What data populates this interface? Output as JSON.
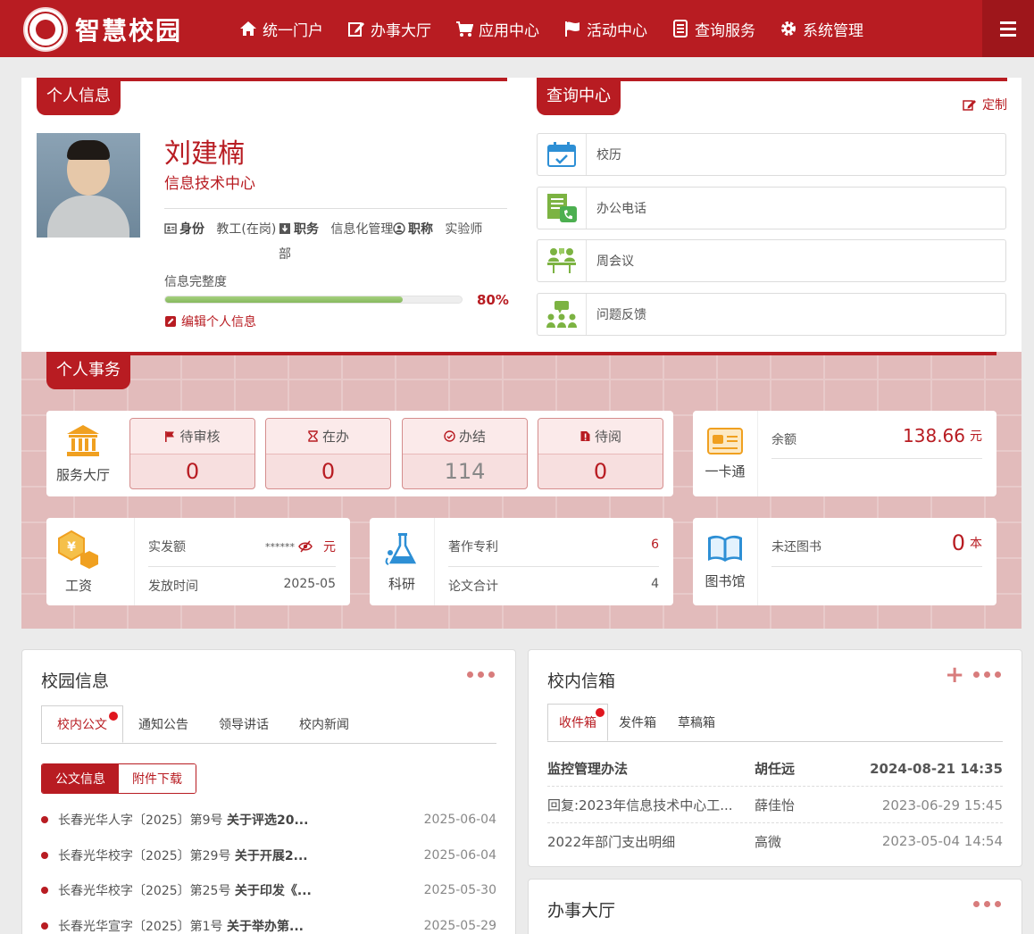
{
  "app": {
    "title": "智慧校园",
    "logo_icon": "school-seal"
  },
  "nav": {
    "items": [
      {
        "label": "统一门户",
        "icon": "home-icon"
      },
      {
        "label": "办事大厅",
        "icon": "edit-icon"
      },
      {
        "label": "应用中心",
        "icon": "cart-icon"
      },
      {
        "label": "活动中心",
        "icon": "flag-icon"
      },
      {
        "label": "查询服务",
        "icon": "list-icon"
      },
      {
        "label": "系统管理",
        "icon": "gear-icon"
      }
    ],
    "menu_icon": "hamburger-icon"
  },
  "profile": {
    "section_title": "个人信息",
    "name": "刘建楠",
    "department": "信息技术中心",
    "identity_label": "身份",
    "identity_value": "教工(在岗)",
    "duty_label": "职务",
    "duty_value": "信息化管理",
    "duty_value_cont": "部",
    "title_label": "职称",
    "title_value": "实验师",
    "completeness_label": "信息完整度",
    "completeness_percent": 80,
    "completeness_text": "80%",
    "edit_label": "编辑个人信息"
  },
  "query": {
    "section_title": "查询中心",
    "custom_label": "定制",
    "items": [
      {
        "label": "校历",
        "icon": "calendar-icon"
      },
      {
        "label": "办公电话",
        "icon": "phone-book-icon"
      },
      {
        "label": "周会议",
        "icon": "meeting-icon"
      },
      {
        "label": "问题反馈",
        "icon": "feedback-icon"
      }
    ]
  },
  "affairs": {
    "section_title": "个人事务",
    "service_hall": {
      "label": "服务大厅",
      "stats": [
        {
          "label": "待审核",
          "value": "0",
          "icon": "flag-icon"
        },
        {
          "label": "在办",
          "value": "0",
          "icon": "hourglass-icon"
        },
        {
          "label": "办结",
          "value": "114",
          "icon": "check-circle-icon"
        },
        {
          "label": "待阅",
          "value": "0",
          "icon": "alert-file-icon"
        }
      ]
    },
    "card": {
      "label": "一卡通",
      "balance_label": "余额",
      "balance_value": "138.66",
      "balance_unit": "元"
    },
    "salary": {
      "label": "工资",
      "actual_label": "实发额",
      "actual_value": "******",
      "actual_unit": "元",
      "date_label": "发放时间",
      "date_value": "2025-05"
    },
    "research": {
      "label": "科研",
      "works_label": "著作专利",
      "works_value": "6",
      "papers_label": "论文合计",
      "papers_value": "4"
    },
    "library": {
      "label": "图书馆",
      "books_label": "未还图书",
      "books_value": "0",
      "books_unit": "本"
    }
  },
  "campus_info": {
    "title": "校园信息",
    "tabs": [
      "校内公文",
      "通知公告",
      "领导讲话",
      "校内新闻"
    ],
    "subtabs": [
      "公文信息",
      "附件下载"
    ],
    "docs": [
      {
        "prefix": "长春光华人字〔2025〕第9号",
        "title": "关于评选20...",
        "date": "2025-06-04"
      },
      {
        "prefix": "长春光华校字〔2025〕第29号",
        "title": "关于开展2...",
        "date": "2025-06-04"
      },
      {
        "prefix": "长春光华校字〔2025〕第25号",
        "title": "关于印发《...",
        "date": "2025-05-30"
      },
      {
        "prefix": "长春光华宣字〔2025〕第1号",
        "title": "关于举办第...",
        "date": "2025-05-29"
      }
    ]
  },
  "mailbox": {
    "title": "校内信箱",
    "tabs": [
      "收件箱",
      "发件箱",
      "草稿箱"
    ],
    "mails": [
      {
        "subject": "监控管理办法",
        "from": "胡任远",
        "time": "2024-08-21 14:35",
        "unread": true
      },
      {
        "subject": "回复:2023年信息技术中心工...",
        "from": "薛佳怡",
        "time": "2023-06-29 15:45",
        "unread": false
      },
      {
        "subject": "2022年部门支出明细",
        "from": "高微",
        "time": "2023-05-04 14:54",
        "unread": false
      }
    ]
  },
  "hall": {
    "title": "办事大厅"
  },
  "colors": {
    "primary": "#b81c22",
    "progress": "#8cbf63"
  }
}
